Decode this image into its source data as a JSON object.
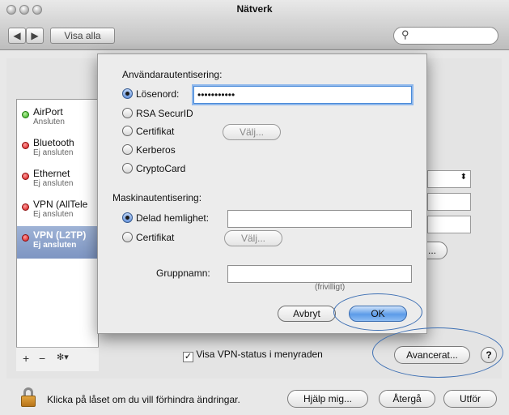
{
  "window": {
    "title": "Nätverk"
  },
  "toolbar": {
    "back_label": "◀",
    "forward_label": "▶",
    "show_all_label": "Visa alla",
    "search_placeholder": ""
  },
  "services": [
    {
      "name": "AirPort",
      "status": "Ansluten",
      "state": "green"
    },
    {
      "name": "Bluetooth",
      "status": "Ej ansluten",
      "state": "red"
    },
    {
      "name": "Ethernet",
      "status": "Ej ansluten",
      "state": "red"
    },
    {
      "name": "VPN (AllTele",
      "status": "Ej ansluten",
      "state": "red"
    },
    {
      "name": "VPN (L2TP)",
      "status": "Ej ansluten",
      "state": "red",
      "selected": true
    }
  ],
  "sidebar_toolbar": {
    "add": "+",
    "remove": "−",
    "gear": "✻▾"
  },
  "sheet": {
    "user_auth_heading": "Användarautentisering:",
    "user_options": [
      {
        "label": "Lösenord:",
        "selected": true
      },
      {
        "label": "RSA SecurID",
        "selected": false
      },
      {
        "label": "Certifikat",
        "selected": false
      },
      {
        "label": "Kerberos",
        "selected": false
      },
      {
        "label": "CryptoCard",
        "selected": false
      }
    ],
    "password_value": "•••••••••••",
    "choose_label_1": "Välj...",
    "machine_auth_heading": "Maskinautentisering:",
    "machine_options": [
      {
        "label": "Delad hemlighet:",
        "selected": true
      },
      {
        "label": "Certifikat",
        "selected": false
      }
    ],
    "shared_secret_value": "",
    "choose_label_2": "Välj...",
    "group_name_label": "Gruppnamn:",
    "group_name_value": "",
    "optional_hint": "(frivilligt)",
    "cancel_label": "Avbryt",
    "ok_label": "OK"
  },
  "main": {
    "show_vpn_status_label": "Visa VPN-status i menyraden",
    "show_vpn_status_checked": true,
    "advanced_label": "Avancerat...",
    "help_label": "?",
    "auth_settings_label": "..."
  },
  "footer": {
    "lock_text": "Klicka på låset om du vill förhindra ändringar.",
    "help_me_label": "Hjälp mig...",
    "revert_label": "Återgå",
    "apply_label": "Utför"
  },
  "colors": {
    "ok_button": "#5c9be8",
    "annotation_circle": "#3d6fb3",
    "selected_row": "#7d95c2"
  }
}
